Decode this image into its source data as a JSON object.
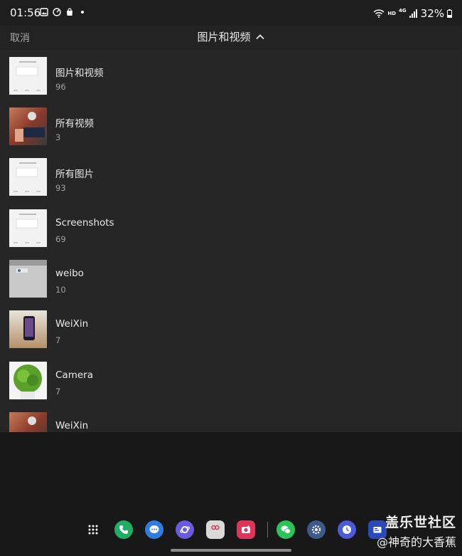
{
  "status_bar": {
    "time": "01:56",
    "network_badge": "HD",
    "network_type": "4G",
    "battery": "32%"
  },
  "header": {
    "cancel_label": "取消",
    "title": "图片和视频"
  },
  "albums": [
    {
      "name": "图片和视频",
      "count": "96"
    },
    {
      "name": "所有视频",
      "count": "3"
    },
    {
      "name": "所有图片",
      "count": "93"
    },
    {
      "name": "Screenshots",
      "count": "69"
    },
    {
      "name": "weibo",
      "count": "10"
    },
    {
      "name": "WeiXin",
      "count": "7"
    },
    {
      "name": "Camera",
      "count": "7"
    },
    {
      "name": "WeiXin",
      "count": ""
    }
  ],
  "taskbar": {
    "apps": [
      "apps-grid-icon",
      "phone-icon",
      "messages-icon",
      "internet-icon",
      "gallery-icon",
      "camera-icon",
      "wechat-icon",
      "settings-icon",
      "clock-icon",
      "samsung-notes-icon"
    ]
  },
  "watermark": {
    "line1": "盖乐世社区",
    "line2": "@神奇的大香蕉"
  },
  "colors": {
    "list_bg": "#262626",
    "header_bg": "#232323",
    "bottom_bg": "#181818"
  }
}
